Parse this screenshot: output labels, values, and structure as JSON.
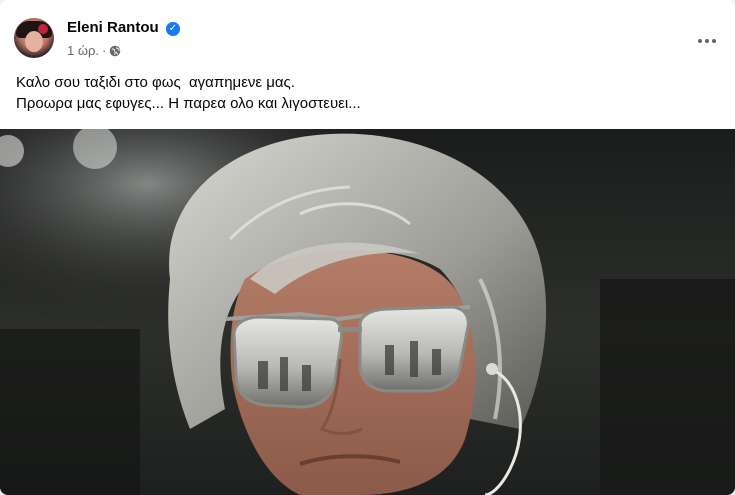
{
  "post": {
    "author": "Eleni Rantou",
    "time": "1 ώρ.",
    "separator": "·",
    "audience_icon": "globe-icon",
    "verified_icon": "verified-badge-icon",
    "more_icon": "more-options-icon",
    "text_lines": [
      "Καλο σου ταξιδι στο φως  αγαπημενε μας.",
      "Προωρα μας εφυγες... Η παρεα ολο και λιγοστευει..."
    ]
  },
  "colors": {
    "brand_blue": "#1877f2",
    "primary_text": "#050505",
    "secondary_text": "#65676b"
  }
}
